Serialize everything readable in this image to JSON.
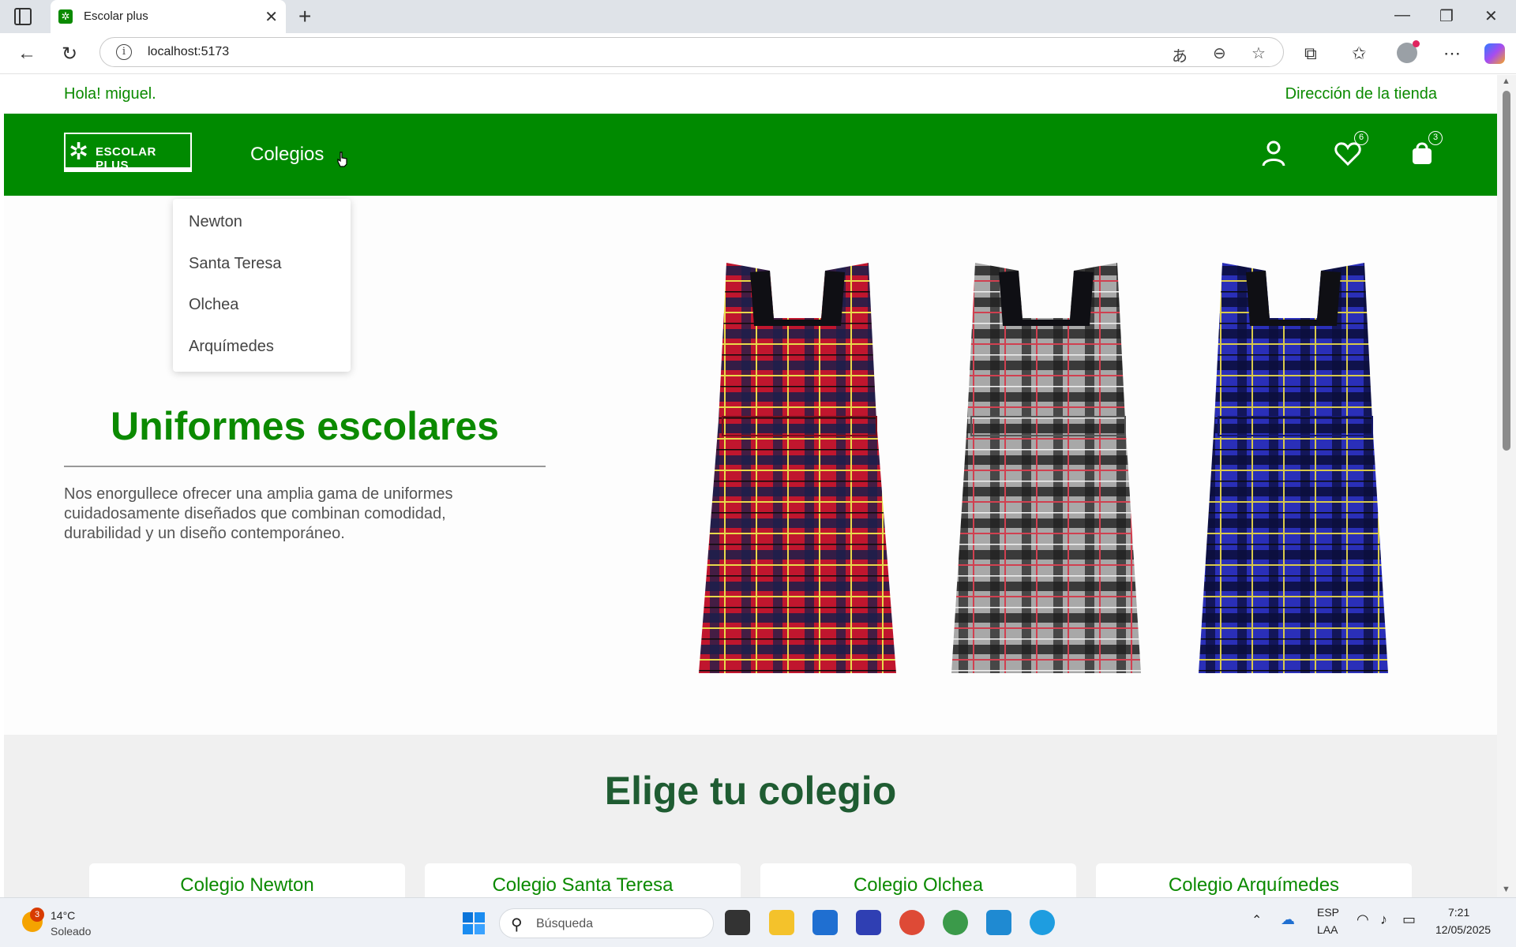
{
  "browser": {
    "tab_title": "Escolar plus",
    "url": "localhost:5173"
  },
  "page": {
    "greeting": "Hola! miguel.",
    "store_link": "Dirección de la tienda",
    "logo_text": "ESCOLAR PLUS",
    "nav_menu_label": "Colegios",
    "wishlist_count": "6",
    "cart_count": "3",
    "dropdown_items": [
      "Newton",
      "Santa Teresa",
      "Olchea",
      "Arquímedes"
    ],
    "hero": {
      "title": "Uniformes escolares",
      "text": "Nos enorgullece ofrecer una amplia gama de uniformes cuidadosamente diseñados que combinan comodidad, durabilidad y un diseño contemporáneo."
    },
    "schools_title": "Elige tu colegio",
    "schools": [
      "Colegio Newton",
      "Colegio Santa Teresa",
      "Colegio Olchea",
      "Colegio Arquímedes"
    ],
    "dresses": [
      {
        "name": "red-plaid",
        "base": "#c0162e",
        "line": "#1b1f4a",
        "stripe": "#e8d94a"
      },
      {
        "name": "grey-plaid",
        "base": "#9a9a9a",
        "line": "#1e1e1e",
        "stripe": "#d04050"
      },
      {
        "name": "blue-plaid",
        "base": "#2a2fb8",
        "line": "#0b0d3a",
        "stripe": "#d8c94a"
      }
    ]
  },
  "taskbar": {
    "weather_badge": "3",
    "weather_temp": "14°C",
    "weather_desc": "Soleado",
    "search_placeholder": "Búsqueda",
    "lang_line1": "ESP",
    "lang_line2": "LAA",
    "time": "7:21",
    "date": "12/05/2025"
  },
  "colors": {
    "brand_green": "#008a00",
    "title_dark_green": "#1f5c32"
  }
}
